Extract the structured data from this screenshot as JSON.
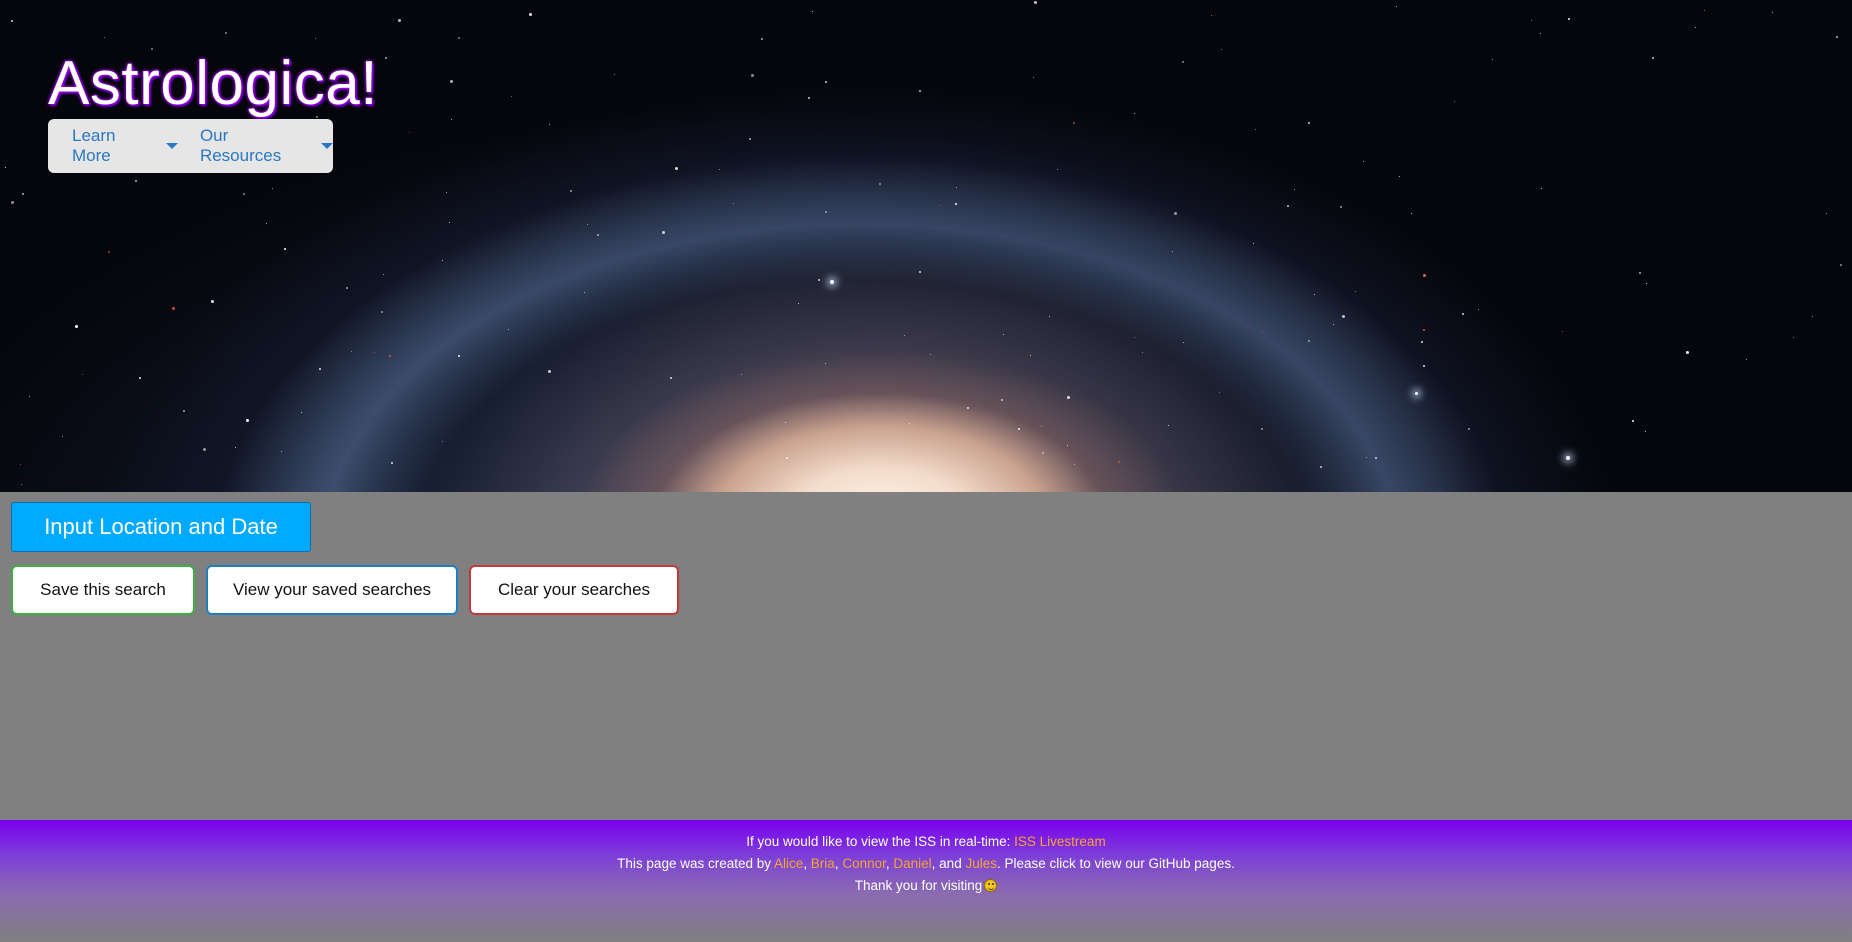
{
  "header": {
    "title": "Astrologica!",
    "nav": [
      {
        "label": "Learn More",
        "icon": "caret-down-icon"
      },
      {
        "label": "Our Resources",
        "icon": "caret-down-icon"
      }
    ]
  },
  "main": {
    "input_button": "Input Location and Date",
    "save_button": "Save this search",
    "view_button": "View your saved searches",
    "clear_button": "Clear your searches"
  },
  "footer": {
    "line1_text": "If you would like to view the ISS in real-time: ",
    "line1_link": "ISS Livestream",
    "line2_prefix": "This page was created by ",
    "creators": [
      "Alice",
      "Bria",
      "Connor",
      "Daniel",
      "Jules"
    ],
    "line2_sep1": ", ",
    "line2_and": ", and ",
    "line2_suffix": ". Please click to view our GitHub pages.",
    "line3": "Thank you for visiting",
    "emoji_icon": "smiley-icon"
  },
  "colors": {
    "primary": "#00aaff",
    "save_border": "#3cb043",
    "view_border": "#1e7fc0",
    "clear_border": "#c0393b",
    "link": "#f4a537",
    "footer_purple": "#7a00f0"
  }
}
